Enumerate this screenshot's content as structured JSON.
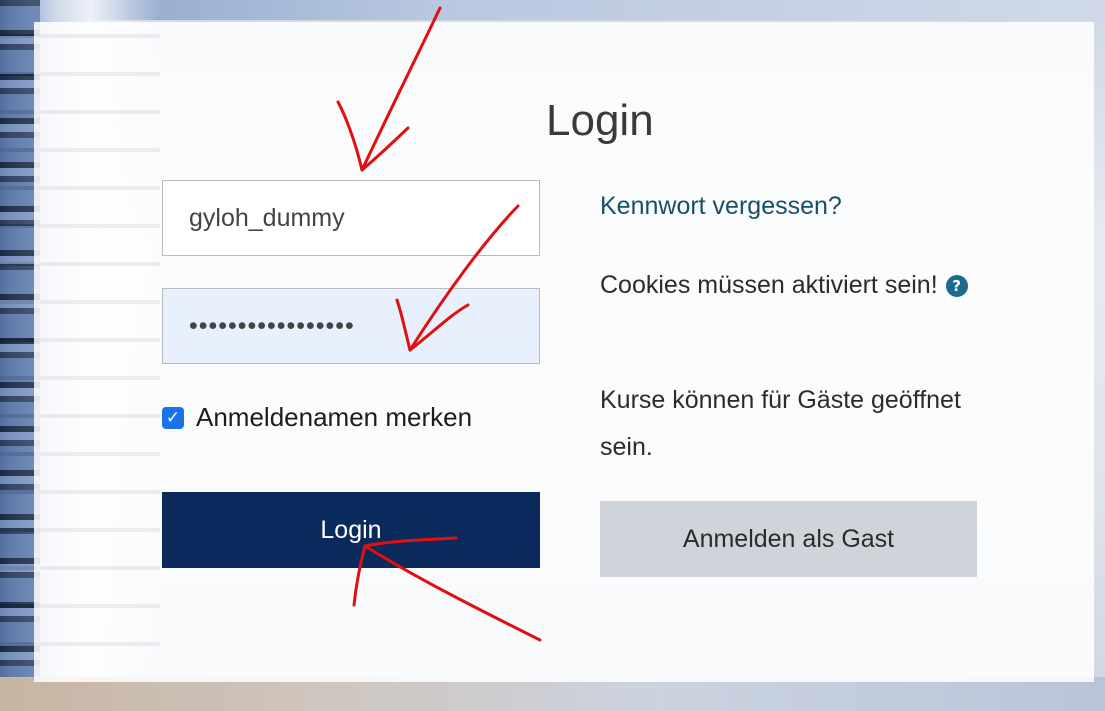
{
  "login": {
    "title": "Login",
    "username_value": "gyloh_dummy",
    "password_value": "•••••••••••••••••",
    "remember_label": "Anmeldenamen merken",
    "remember_checked": true,
    "login_button": "Login"
  },
  "info": {
    "forgot_link": "Kennwort vergessen?",
    "cookies_text": "Cookies müssen aktiviert sein!",
    "courses_text": "Kurse können für Gäste geöffnet sein.",
    "guest_button": "Anmelden als Gast"
  },
  "colors": {
    "login_button_bg": "#0a2a5c",
    "guest_button_bg": "#ced4da",
    "link": "#1a4e6a",
    "annotation_red": "#e01010"
  },
  "icons": {
    "help": "question-circle-icon",
    "checkbox": "checkmark-icon"
  }
}
